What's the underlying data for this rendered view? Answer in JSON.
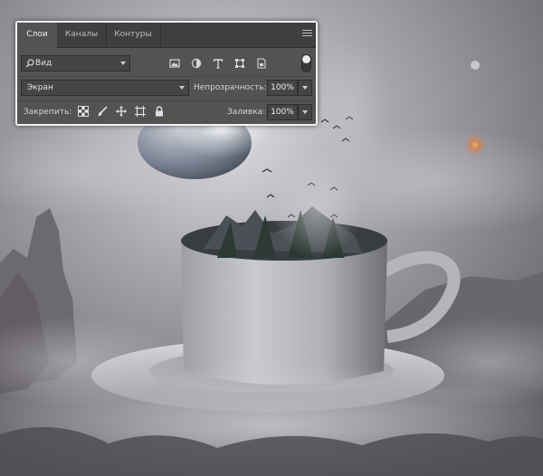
{
  "panel": {
    "tabs": [
      "Слои",
      "Каналы",
      "Контуры"
    ],
    "active_tab": "Слои",
    "filter": {
      "kind_label": "Вид",
      "icons": [
        "pixel-layer-filter-icon",
        "adjustment-layer-filter-icon",
        "type-layer-filter-icon",
        "shape-layer-filter-icon",
        "smart-object-filter-icon"
      ]
    },
    "blend_mode": "Экран",
    "opacity_label": "Непрозрачность:",
    "opacity_value": "100%",
    "lock_label": "Закрепить:",
    "lock_icons": [
      "lock-transparent-pixels-icon",
      "lock-image-pixels-icon",
      "lock-position-icon",
      "lock-artboard-icon",
      "lock-all-icon"
    ],
    "fill_label": "Заливка:",
    "fill_value": "100%"
  },
  "colors": {
    "panel_bg": "#535353",
    "tab_bar_bg": "#3f3f3f",
    "panel_border": "#f2f2f2",
    "scene_sky": "#8b8890"
  }
}
